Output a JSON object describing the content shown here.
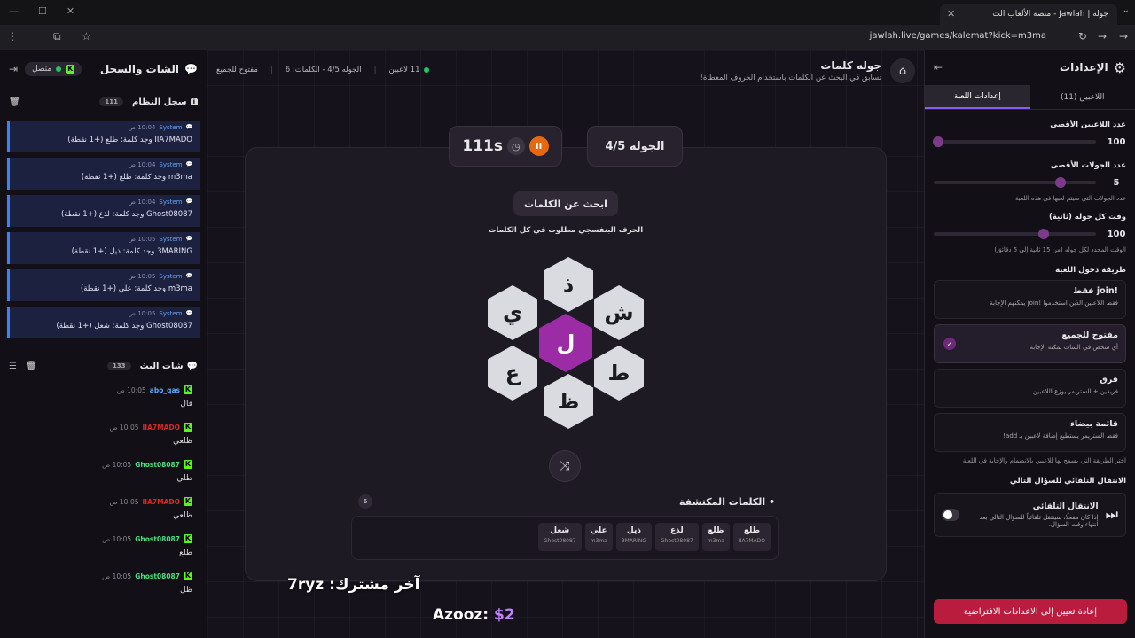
{
  "browser": {
    "tab_title": "جوله | Jawlah - منصة الألعاب الت",
    "url": "jawlah.live/games/kalemat?kick=m3ma"
  },
  "left_panel": {
    "title": "الشات والسجل",
    "status": "متصل",
    "system_log": {
      "title": "سجل النظام",
      "count": "111",
      "items": [
        {
          "sender": "System",
          "time": "10:04 ص",
          "text": "IIA7MADO وجد كلمة: طلع (+1 نقطة)"
        },
        {
          "sender": "System",
          "time": "10:04 ص",
          "text": "m3ma وجد كلمة: ظلع (+1 نقطة)"
        },
        {
          "sender": "System",
          "time": "10:04 ص",
          "text": "Ghost08087 وجد كلمة: لذع (+1 نقطة)"
        },
        {
          "sender": "System",
          "time": "10:05 ص",
          "text": "3MARING وجد كلمة: ذيل (+1 نقطة)"
        },
        {
          "sender": "System",
          "time": "10:05 ص",
          "text": "m3ma وجد كلمة: علي (+1 نقطة)"
        },
        {
          "sender": "System",
          "time": "10:05 ص",
          "text": "Ghost08087 وجد كلمة: شعل (+1 نقطة)"
        }
      ]
    },
    "stream_chat": {
      "title": "شات البث",
      "count": "133",
      "items": [
        {
          "user": "abo_qas",
          "color": "#60a5fa",
          "time": "10:05 ص",
          "text": "قال"
        },
        {
          "user": "IIA7MADO",
          "color": "#dc2626",
          "time": "10:05 ص",
          "text": "ظلعي"
        },
        {
          "user": "Ghost08087",
          "color": "#4ade80",
          "time": "10:05 ص",
          "text": "طلي"
        },
        {
          "user": "IIA7MADO",
          "color": "#dc2626",
          "time": "10:05 ص",
          "text": "ظلعي"
        },
        {
          "user": "Ghost08087",
          "color": "#4ade80",
          "time": "10:05 ص",
          "text": "طلع"
        },
        {
          "user": "Ghost08087",
          "color": "#4ade80",
          "time": "10:05 ص",
          "text": "ظل"
        }
      ]
    }
  },
  "game": {
    "title": "جوله كلمات",
    "subtitle": "تسابق في البحث عن الكلمات باستخدام الحروف المعطاة!",
    "players_info": "11 لاعبين",
    "round_info": "الجوله 4/5 - الكلمات: 6",
    "mode_info": "مفتوح للجميع",
    "round_label": "الجوله 4/5",
    "timer": "111s",
    "find_label": "ابحث عن الكلمات",
    "hint": "الحرف البنفسجي مطلوب في كل الكلمات",
    "letters": {
      "center": "ل",
      "top": "ذ",
      "top_right": "ش",
      "bottom_right": "ط",
      "bottom": "ظ",
      "bottom_left": "ع",
      "top_left": "ي"
    },
    "found_title": "• الكلمات المكتشفة",
    "found_count": "6",
    "found_words": [
      {
        "word": "طلع",
        "player": "IIA7MADO"
      },
      {
        "word": "ظلع",
        "player": "m3ma"
      },
      {
        "word": "لذع",
        "player": "Ghost08087"
      },
      {
        "word": "ذيل",
        "player": "3MARING"
      },
      {
        "word": "علي",
        "player": "m3ma"
      },
      {
        "word": "شعل",
        "player": "Ghost08087"
      }
    ],
    "overlay_last_sub": "آخر مشترك: 7ryz",
    "overlay_donor_name": "Azooz:",
    "overlay_donor_amount": "$2"
  },
  "settings": {
    "title": "الإعدادات",
    "tab_players": "اللاعبين (11)",
    "tab_game": "إعدادات اللعبة",
    "max_players_label": "عدد اللاعبين الأقصى",
    "max_players_value": "100",
    "max_players_fraction": 0.0,
    "max_rounds_label": "عدد الجولات الأقصى",
    "max_rounds_value": "5",
    "max_rounds_fraction": 0.78,
    "max_rounds_sub": "عدد الجولات التي سيتم لعبها في هذه اللعبة",
    "round_time_label": "وقت كل جوله (ثانية)",
    "round_time_value": "100",
    "round_time_fraction": 0.68,
    "round_time_sub": "الوقت المحدد لكل جوله (من 15 ثانية إلى 5 دقائق)",
    "entry_label": "طريقة دخول اللعبة",
    "entry_options": [
      {
        "title": "!join فقط",
        "desc": "فقط اللاعبين الذين استخدموا !join يمكنهم الإجابة",
        "selected": false
      },
      {
        "title": "مفتوح للجميع",
        "desc": "أي شخص في الشات يمكنه الإجابة",
        "selected": true
      },
      {
        "title": "فرق",
        "desc": "فريقين + الستريمر يوزع اللاعبين",
        "selected": false
      },
      {
        "title": "قائمة بيضاء",
        "desc": "فقط الستريمر يستطيع إضافة لاعبين بـ add!",
        "selected": false
      }
    ],
    "entry_sub": "اختر الطريقة التي يسمح بها للاعبين بالانضمام والإجابة في اللعبة",
    "auto_label": "الانتقال التلقائي للسؤال التالي",
    "auto_title": "الانتقال التلقائي",
    "auto_desc": "إذا كان مفعلًا، سينتقل تلقائياً للسؤال التالي بعد انتهاء وقت السؤال.",
    "auto_enabled": false,
    "reset_label": "إعادة تعيين إلى الاعدادات الافتراضية"
  }
}
